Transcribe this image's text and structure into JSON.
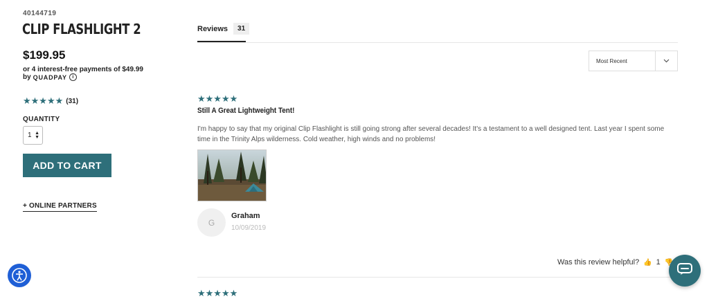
{
  "product": {
    "sku": "40144719",
    "title": "CLIP FLASHLIGHT 2",
    "price": "$199.95",
    "installments": "or 4 interest-free payments of $49.99",
    "by_label": "by",
    "quadpay_brand": "QUADPAY",
    "info_glyph": "i",
    "rating_stars": "★★★★★",
    "rating_count": "(31)",
    "quantity_label": "QUANTITY",
    "quantity_value": "1",
    "add_to_cart": "ADD TO CART",
    "online_partners": "+ ONLINE PARTNERS"
  },
  "reviews_tab": {
    "label": "Reviews",
    "count": "31"
  },
  "sort": {
    "selected": "Most Recent"
  },
  "review": {
    "stars": "★★★★★",
    "title": "Still A Great Lightweight Tent!",
    "body": "I'm happy to say that my original Clip Flashlight is still going strong after several decades! It's a testament to a well designed tent. Last year I spent some time in the Trinity Alps wilderness. Cold weather, high winds and no problems!",
    "avatar_initial": "G",
    "reviewer": "Graham",
    "date": "10/09/2019",
    "helpful_question": "Was this review helpful?",
    "helpful_yes_count": "1"
  },
  "next_review": {
    "stars": "★★★★★"
  },
  "colors": {
    "accent": "#2e6f7a",
    "accessibility": "#1f5fd6"
  },
  "icons": [
    "info-icon",
    "chevron-down-icon",
    "thumbs-up-icon",
    "thumbs-down-icon",
    "accessibility-icon",
    "chat-icon",
    "up-down-arrows-icon"
  ]
}
